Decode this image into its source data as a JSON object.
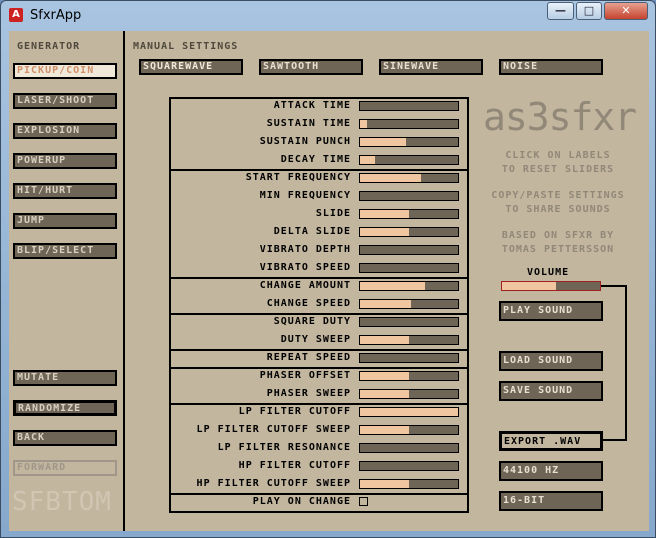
{
  "window": {
    "title": "SfxrApp",
    "app_icon_glyph": "A",
    "min_glyph": "—",
    "max_glyph": "□",
    "close_glyph": "✕"
  },
  "generator": {
    "heading": "GENERATOR",
    "items": [
      "PICKUP/COIN",
      "LASER/SHOOT",
      "EXPLOSION",
      "POWERUP",
      "HIT/HURT",
      "JUMP",
      "BLIP/SELECT"
    ],
    "selected": "PICKUP/COIN",
    "actions": [
      "MUTATE",
      "RANDOMIZE",
      "BACK",
      "FORWARD"
    ],
    "watermark": "SFBTOM"
  },
  "manual": {
    "heading": "MANUAL SETTINGS",
    "waveforms": [
      "SQUAREWAVE",
      "SAWTOOTH",
      "SINEWAVE",
      "NOISE"
    ],
    "selected_waveform": "SQUAREWAVE",
    "sliders": [
      {
        "label": "ATTACK TIME",
        "value": 0.0
      },
      {
        "label": "SUSTAIN TIME",
        "value": 0.07
      },
      {
        "label": "SUSTAIN PUNCH",
        "value": 0.47
      },
      {
        "label": "DECAY TIME",
        "value": 0.15
      },
      {
        "label": "START FREQUENCY",
        "value": 0.62
      },
      {
        "label": "MIN FREQUENCY",
        "value": 0.0
      },
      {
        "label": "SLIDE",
        "value": 0.5
      },
      {
        "label": "DELTA SLIDE",
        "value": 0.5
      },
      {
        "label": "VIBRATO DEPTH",
        "value": 0.0
      },
      {
        "label": "VIBRATO SPEED",
        "value": 0.0
      },
      {
        "label": "CHANGE AMOUNT",
        "value": 0.66
      },
      {
        "label": "CHANGE SPEED",
        "value": 0.52
      },
      {
        "label": "SQUARE DUTY",
        "value": 0.0
      },
      {
        "label": "DUTY SWEEP",
        "value": 0.5
      },
      {
        "label": "REPEAT SPEED",
        "value": 0.0
      },
      {
        "label": "PHASER OFFSET",
        "value": 0.5
      },
      {
        "label": "PHASER SWEEP",
        "value": 0.5
      },
      {
        "label": "LP FILTER CUTOFF",
        "value": 1.0
      },
      {
        "label": "LP FILTER CUTOFF SWEEP",
        "value": 0.5
      },
      {
        "label": "LP FILTER RESONANCE",
        "value": 0.0
      },
      {
        "label": "HP FILTER CUTOFF",
        "value": 0.0
      },
      {
        "label": "HP FILTER CUTOFF SWEEP",
        "value": 0.5
      }
    ],
    "play_on_change_label": "PLAY ON CHANGE",
    "play_on_change_checked": false
  },
  "info": {
    "logo": "as3sfxr",
    "hint1_line1": "CLICK ON LABELS",
    "hint1_line2": "TO RESET SLIDERS",
    "hint2_line1": "COPY/PASTE SETTINGS",
    "hint2_line2": "TO SHARE SOUNDS",
    "credit_line1": "BASED ON SFXR BY",
    "credit_line2": "TOMAS PETTERSSON"
  },
  "volume": {
    "label": "VOLUME",
    "value": 0.55
  },
  "right_buttons": {
    "play": "PLAY SOUND",
    "load": "LOAD SOUND",
    "save": "SAVE SOUND",
    "export": "EXPORT .WAV",
    "rate": "44100 HZ",
    "bits": "16-BIT"
  },
  "colors": {
    "panel": "#c2b69e",
    "track": "#6f6557",
    "fill": "#f0c6a0",
    "accent": "#a02020"
  }
}
